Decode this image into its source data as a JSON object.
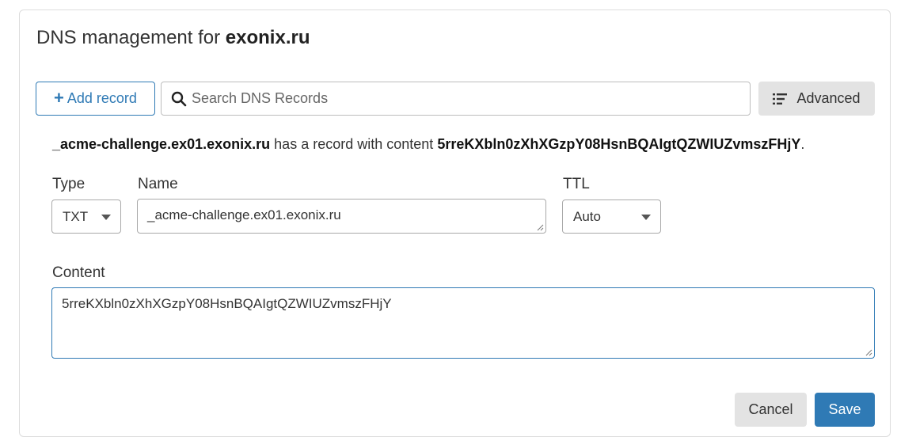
{
  "header": {
    "title_prefix": "DNS management for",
    "domain": "exonix.ru"
  },
  "toolbar": {
    "add_record_label": "Add record",
    "search_placeholder": "Search DNS Records",
    "search_value": "",
    "advanced_label": "Advanced"
  },
  "summary": {
    "record_name": "_acme-challenge.ex01.exonix.ru",
    "middle_text": "has a record with content",
    "record_content": "5rreKXbln0zXhXGzpY08HsnBQAIgtQZWIUZvmszFHjY",
    "end": "."
  },
  "form": {
    "type_label": "Type",
    "type_value": "TXT",
    "name_label": "Name",
    "name_value": "_acme-challenge.ex01.exonix.ru",
    "ttl_label": "TTL",
    "ttl_value": "Auto",
    "content_label": "Content",
    "content_value": "5rreKXbln0zXhXGzpY08HsnBQAIgtQZWIUZvmszFHjY"
  },
  "actions": {
    "cancel_label": "Cancel",
    "save_label": "Save"
  },
  "icons": {
    "add": "plus-icon",
    "search": "search-icon",
    "advanced": "list-icon",
    "dropdown": "chevron-down-icon"
  },
  "colors": {
    "accent": "#2f7ab5",
    "secondary_button": "#e3e3e3"
  }
}
